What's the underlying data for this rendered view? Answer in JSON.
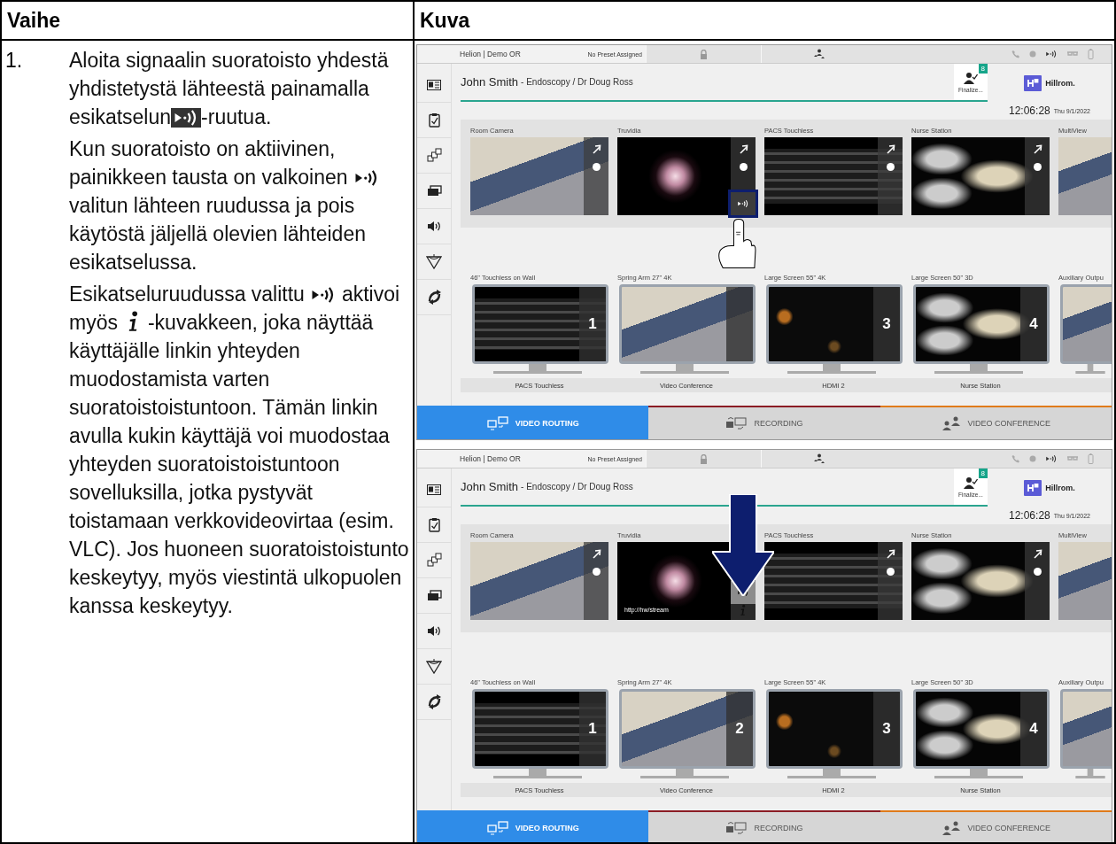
{
  "table": {
    "headers": [
      "Vaihe",
      "Kuva"
    ]
  },
  "step": {
    "number": "1.",
    "paragraphs": [
      [
        {
          "kind": "text",
          "text": "Aloita signaalin suoratoisto yhdestä yhdistetystä lähteestä painamalla esikatselun"
        },
        {
          "kind": "stream-dark"
        },
        {
          "kind": "text",
          "text": "-ruutua."
        }
      ],
      [
        {
          "kind": "text",
          "text": "Kun suoratoisto on aktiivinen, painikkeen tausta on valkoinen"
        },
        {
          "kind": "stream"
        },
        {
          "kind": "text",
          "text": "valitun lähteen ruudussa ja pois käytöstä jäljellä olevien lähteiden esikatselussa."
        }
      ],
      [
        {
          "kind": "text",
          "text": "Esikatseluruudussa valittu"
        },
        {
          "kind": "stream"
        },
        {
          "kind": "text",
          "text": "aktivoi myös"
        },
        {
          "kind": "info"
        },
        {
          "kind": "text",
          "text": "-kuvakkeen, joka näyttää käyttäjälle linkin yhteyden muodostamista varten suoratoistoistuntoon. Tämän linkin avulla kukin käyttäjä voi muodostaa yhteyden suoratoistoistuntoon sovelluksilla, jotka pystyvät toistamaan verkkovideovirtaa (esim. VLC). Jos huoneen suoratoistoistunto keskeytyy, myös viestintä ulkopuolen kanssa keskeytyy."
        }
      ]
    ]
  },
  "screens": [
    {
      "annotation": {
        "kind": "hand"
      },
      "room": "Helion | Demo OR",
      "preset": "No Preset Assigned",
      "patient": "John Smith",
      "procedure": "- Endoscopy / Dr Doug Ross",
      "finalize": {
        "label": "Finalize...",
        "count": "8"
      },
      "logo": "Hillrom.",
      "time": "12:06:28",
      "date": "Thu 9/1/2022",
      "sources": [
        {
          "name": "Room Camera",
          "kind": "room",
          "stream_button": false,
          "streaming": false
        },
        {
          "name": "Truvidia",
          "kind": "endoscope",
          "stream_button": true,
          "streaming": false
        },
        {
          "name": "PACS Touchless",
          "kind": "document",
          "stream_button": false,
          "streaming": false
        },
        {
          "name": "Nurse Station",
          "kind": "scan",
          "stream_button": false,
          "streaming": false
        },
        {
          "name": "MultiView",
          "kind": "room",
          "cut": true
        }
      ],
      "destinations": [
        {
          "name": "46\" Touchless on Wall",
          "number": "1",
          "kind": "document",
          "source": "PACS Touchless"
        },
        {
          "name": "Spring Arm 27\" 4K",
          "kind": "room",
          "source": "Video Conference"
        },
        {
          "name": "Large Screen 55\" 4K",
          "number": "3",
          "kind": "dark",
          "source": "HDMI 2"
        },
        {
          "name": "Large Screen 50\" 3D",
          "number": "4",
          "kind": "scan",
          "source": "Nurse Station"
        },
        {
          "name": "Auxiliary Outpu",
          "kind": "room",
          "cut": true
        }
      ],
      "tabs": [
        {
          "label": "VIDEO ROUTING",
          "selected": true,
          "color": "#2f8ce8"
        },
        {
          "label": "RECORDING",
          "selected": false,
          "color": "#8b1c24"
        },
        {
          "label": "VIDEO CONFERENCE",
          "selected": false,
          "color": "#e07b1a"
        }
      ]
    },
    {
      "annotation": {
        "kind": "arrow"
      },
      "room": "Helion | Demo OR",
      "preset": "No Preset Assigned",
      "patient": "John Smith",
      "procedure": "- Endoscopy / Dr Doug Ross",
      "finalize": {
        "label": "Finalize...",
        "count": "8"
      },
      "logo": "Hillrom.",
      "time": "12:06:28",
      "date": "Thu 9/1/2022",
      "sources": [
        {
          "name": "Room Camera",
          "kind": "room",
          "stream_button": false,
          "streaming": false
        },
        {
          "name": "Truvidia",
          "kind": "endoscope",
          "stream_button": true,
          "streaming": true,
          "url": "http://hw/stream"
        },
        {
          "name": "PACS Touchless",
          "kind": "document",
          "stream_button": false,
          "streaming": false
        },
        {
          "name": "Nurse Station",
          "kind": "scan",
          "stream_button": false,
          "streaming": false
        },
        {
          "name": "MultiView",
          "kind": "room",
          "cut": true
        }
      ],
      "destinations": [
        {
          "name": "46\" Touchless on Wall",
          "number": "1",
          "kind": "document",
          "source": "PACS Touchless"
        },
        {
          "name": "Spring Arm 27\" 4K",
          "number": "2",
          "kind": "room",
          "source": "Video Conference"
        },
        {
          "name": "Large Screen 55\" 4K",
          "number": "3",
          "kind": "dark",
          "source": "HDMI 2"
        },
        {
          "name": "Large Screen 50\" 3D",
          "number": "4",
          "kind": "scan",
          "source": "Nurse Station"
        },
        {
          "name": "Auxiliary Outpu",
          "kind": "room",
          "cut": true
        }
      ],
      "tabs": [
        {
          "label": "VIDEO ROUTING",
          "selected": true,
          "color": "#2f8ce8"
        },
        {
          "label": "RECORDING",
          "selected": false,
          "color": "#8b1c24"
        },
        {
          "label": "VIDEO CONFERENCE",
          "selected": false,
          "color": "#e07b1a"
        }
      ]
    }
  ]
}
